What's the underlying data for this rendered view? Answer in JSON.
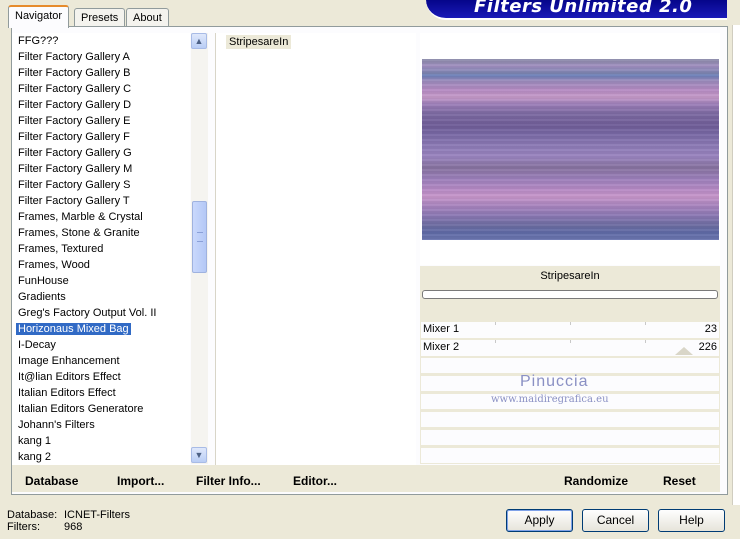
{
  "tabs": [
    {
      "label": "Navigator",
      "active": true
    },
    {
      "label": "Presets",
      "active": false
    },
    {
      "label": "About",
      "active": false
    }
  ],
  "banner": {
    "title": "Filters Unlimited 2.0"
  },
  "categories": [
    "FFG???",
    "Filter Factory Gallery A",
    "Filter Factory Gallery B",
    "Filter Factory Gallery C",
    "Filter Factory Gallery D",
    "Filter Factory Gallery E",
    "Filter Factory Gallery F",
    "Filter Factory Gallery G",
    "Filter Factory Gallery M",
    "Filter Factory Gallery S",
    "Filter Factory Gallery T",
    "Frames, Marble & Crystal",
    "Frames, Stone & Granite",
    "Frames, Textured",
    "Frames, Wood",
    "FunHouse",
    "Gradients",
    "Greg's Factory Output Vol. II",
    "Horizonaus Mixed Bag",
    "I-Decay",
    "Image Enhancement",
    "It@lian Editors Effect",
    "Italian Editors Effect",
    "Italian Editors Generatore",
    "Johann's Filters",
    "kang 1",
    "kang 2"
  ],
  "selected_category": "Horizonaus Mixed Bag",
  "filters": [
    "StripesareIn"
  ],
  "selected_filter": "StripesareIn",
  "filter_name": "StripesareIn",
  "sliders": [
    {
      "label": "Mixer 1",
      "value": "23"
    },
    {
      "label": "Mixer 2",
      "value": "226"
    }
  ],
  "watermark": {
    "name": "Pinuccia",
    "url": "www.maidiregrafica.eu"
  },
  "toolbar": {
    "database": "Database",
    "import": "Import...",
    "filter_info": "Filter Info...",
    "editor": "Editor...",
    "randomize": "Randomize",
    "reset": "Reset"
  },
  "status": {
    "database_label": "Database:",
    "database_value": "ICNET-Filters",
    "filters_label": "Filters:",
    "filters_value": "968"
  },
  "buttons": {
    "apply": "Apply",
    "cancel": "Cancel",
    "help": "Help"
  },
  "colors": {
    "selection": "#316ac5",
    "banner": "#0a0a9e",
    "preview_mid": "#8c7ab5"
  }
}
